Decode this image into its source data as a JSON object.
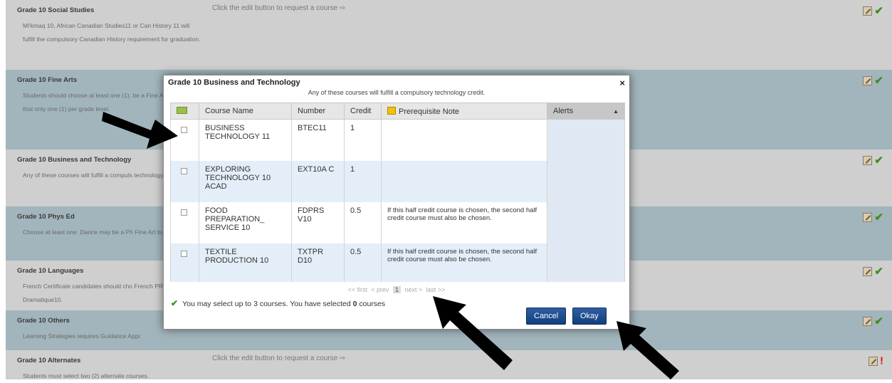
{
  "groups": [
    {
      "title": "Grade 10 Social Studies",
      "desc": "Mi'kmaq 10, African Canadian Studies11 or Can History 11 will fulfill the compulsory Canadian History requirement for graduation.",
      "req": "Click the edit button to request a course ⇨"
    },
    {
      "title": "Grade 10 Fine Arts",
      "desc": "Students should choose at least one (1). be a Fine Art or P note that only one (1) per grade level.",
      "req": ""
    },
    {
      "title": "Grade 10 Business and Technology",
      "desc": "Any of these courses will fulfill a compuls technology credit.",
      "req": ""
    },
    {
      "title": "Grade 10 Phys Ed",
      "desc": "Choose at least one. Dance may be a Ph Fine Art but not both.",
      "req": ""
    },
    {
      "title": "Grade 10 Languages",
      "desc": "French Certificate candidates should cho French PREIB10 and Art Dramatique10.",
      "req": ""
    },
    {
      "title": "Grade 10 Others",
      "desc": "Learning Strategies requires Guidance Appr",
      "req": ""
    },
    {
      "title": "Grade 10 Alternates",
      "desc": "Students must select two (2) alternate courses.",
      "req": "Click the edit button to request a course ⇨"
    }
  ],
  "modal": {
    "title": "Grade 10 Business and Technology",
    "close": "×",
    "subtitle": "Any of these courses will fulfill a compulsory technology credit.",
    "columns": {
      "name": "Course Name",
      "number": "Number",
      "credit": "Credit",
      "note": "Prerequisite Note",
      "alerts": "Alerts"
    },
    "courses": [
      {
        "name": "BUSINESS TECHNOLOGY 11",
        "number": "BTEC11",
        "credit": "1",
        "note": ""
      },
      {
        "name": "EXPLORING TECHNOLOGY 10 ACAD",
        "number": "EXT10A C",
        "credit": "1",
        "note": ""
      },
      {
        "name": "FOOD PREPARATION_ SERVICE 10",
        "number": "FDPRS V10",
        "credit": "0.5",
        "note": "If this half credit course is chosen, the second half credit course must also be chosen."
      },
      {
        "name": "TEXTILE PRODUCTION 10",
        "number": "TXTPR D10",
        "credit": "0.5",
        "note": "If this half credit course is chosen, the second half credit course must also be chosen."
      }
    ],
    "pager": {
      "first": "<< first",
      "prev": "< prev",
      "page": "1",
      "next": "next >",
      "last": "last >>"
    },
    "status_pre": "You may select up to 3 courses. You have selected ",
    "status_count": "0",
    "status_post": " courses",
    "cancel": "Cancel",
    "okay": "Okay"
  },
  "colors": {
    "accent_blue": "#1a4a8a",
    "check_green": "#3f8d1d",
    "alert_red": "#c7201e",
    "row_blue": "#a2b5bc",
    "row_gray": "#cfcfcf"
  }
}
